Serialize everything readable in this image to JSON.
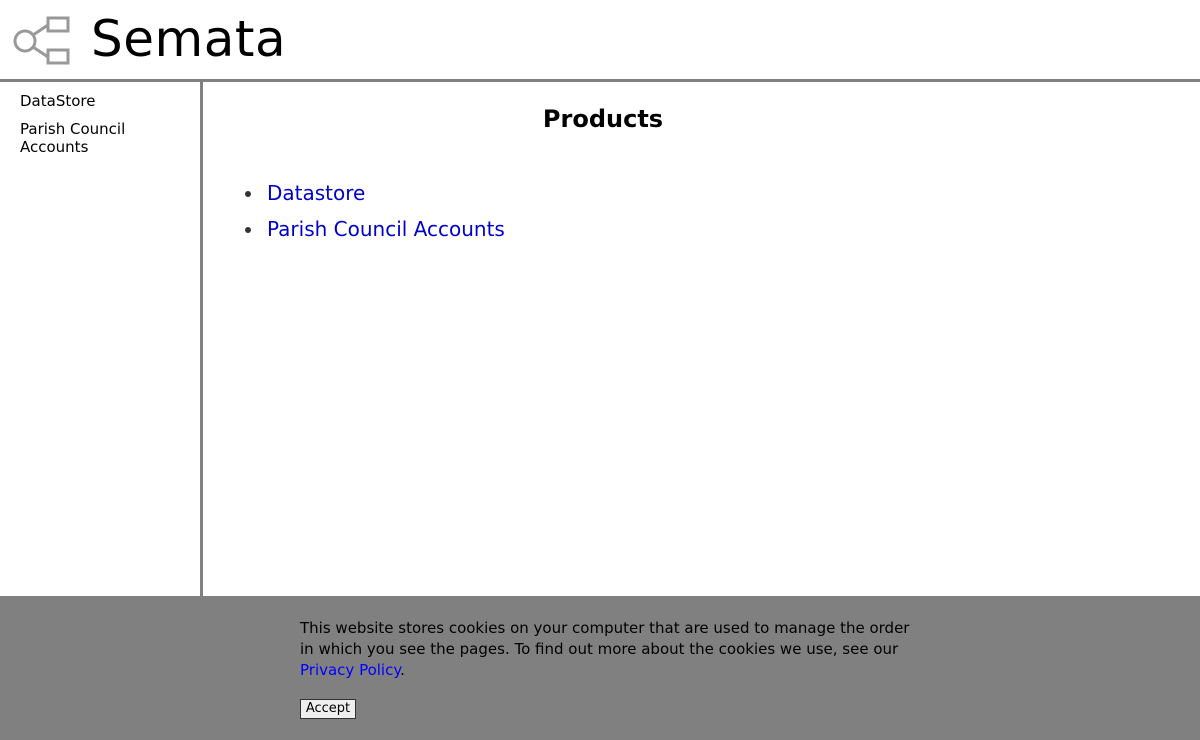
{
  "header": {
    "site_title": "Semata",
    "logo_icon": "network-nodes-icon"
  },
  "sidebar": {
    "items": [
      {
        "label": "DataStore"
      },
      {
        "label": "Parish Council Accounts"
      }
    ]
  },
  "main": {
    "title": "Products",
    "products": [
      {
        "label": "Datastore"
      },
      {
        "label": "Parish Council Accounts"
      }
    ]
  },
  "cookie_banner": {
    "text": "This website stores cookies on your computer that are used to manage the order in which you see the pages. To find out more about the cookies we use, see our ",
    "privacy_link": "Privacy Policy",
    "text_end": ".",
    "accept_label": "Accept"
  },
  "colors": {
    "link": "#0000cc",
    "divider": "#808080",
    "banner_bg": "#808080"
  }
}
